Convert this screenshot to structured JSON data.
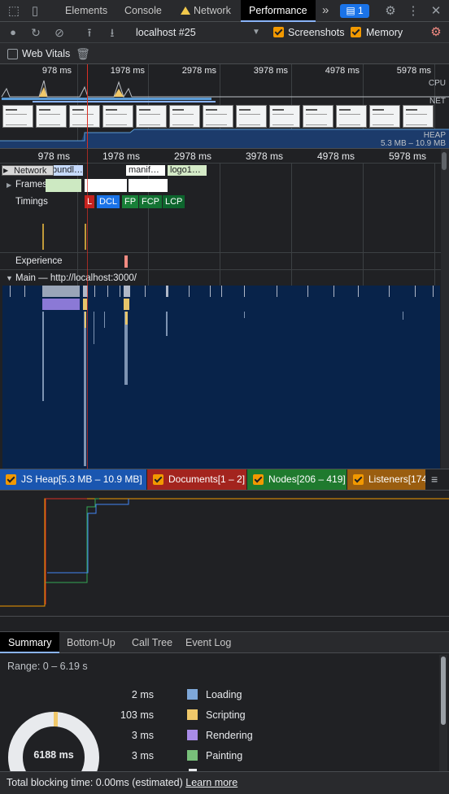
{
  "tabs": {
    "elements": "Elements",
    "console": "Console",
    "network": "Network",
    "performance": "Performance",
    "more": "»",
    "issues_count": "1"
  },
  "toolbar": {
    "profile": "localhost #25",
    "screenshots": "Screenshots",
    "memory": "Memory",
    "web_vitals": "Web Vitals"
  },
  "overview": {
    "ticks": [
      "978 ms",
      "1978 ms",
      "2978 ms",
      "3978 ms",
      "4978 ms",
      "5978 ms"
    ],
    "cpu": "CPU",
    "net": "NET",
    "heap": "HEAP",
    "heap_range": "5.3 MB – 10.9 MB"
  },
  "flame": {
    "ticks": [
      "978 ms",
      "1978 ms",
      "2978 ms",
      "3978 ms",
      "4978 ms",
      "5978 ms"
    ],
    "network": "Network",
    "network_items": [
      "bundl…",
      "manif…",
      "logo1…"
    ],
    "frames": "Frames",
    "timings": "Timings",
    "experience": "Experience",
    "markers": [
      "L",
      "DCL",
      "FP",
      "FCP",
      "LCP"
    ],
    "main": "Main — http://localhost:3000/"
  },
  "memory": {
    "legend": [
      {
        "label": "JS Heap[5.3 MB – 10.9 MB]",
        "color": "#1a56b0"
      },
      {
        "label": "Documents[1 – 2]",
        "color": "#a3241e"
      },
      {
        "label": "Nodes[206 – 419]",
        "color": "#1f7a2e"
      },
      {
        "label": "Listeners[174",
        "color": "#9a5d0f"
      }
    ]
  },
  "details": {
    "tabs": [
      "Summary",
      "Bottom-Up",
      "Call Tree",
      "Event Log"
    ],
    "range": "Range: 0 – 6.19 s",
    "total": "6188 ms",
    "rows": [
      {
        "value": "2 ms",
        "name": "Loading",
        "color": "#7ea7d8"
      },
      {
        "value": "103 ms",
        "name": "Scripting",
        "color": "#f0c86a"
      },
      {
        "value": "3 ms",
        "name": "Rendering",
        "color": "#a98ce8"
      },
      {
        "value": "3 ms",
        "name": "Painting",
        "color": "#78c07a"
      }
    ]
  },
  "footer": {
    "text": "Total blocking time: 0.00ms (estimated)",
    "link": "Learn more"
  }
}
